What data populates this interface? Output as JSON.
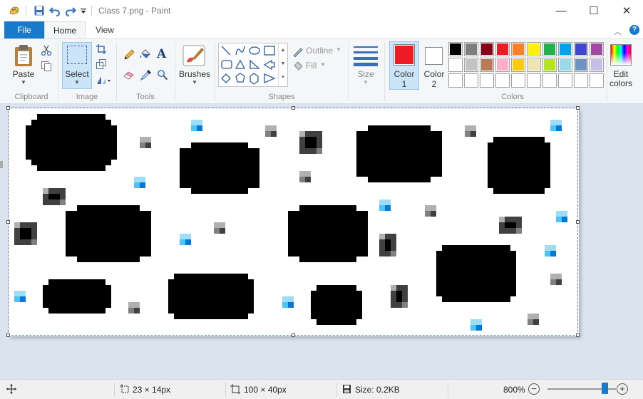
{
  "window": {
    "title": "Class 7.png - Paint",
    "minimize": "—",
    "maximize": "☐",
    "close": "✕"
  },
  "tabs": {
    "file": "File",
    "home": "Home",
    "view": "View"
  },
  "ribbon": {
    "clipboard": {
      "label": "Clipboard",
      "paste": "Paste"
    },
    "image": {
      "label": "Image",
      "select": "Select"
    },
    "tools": {
      "label": "Tools"
    },
    "brushes": {
      "label": "Brushes"
    },
    "shapes": {
      "label": "Shapes",
      "outline": "Outline",
      "fill": "Fill"
    },
    "size": {
      "label": "Size"
    },
    "color1": {
      "label": "Color",
      "num": "1",
      "value": "#ed1c24"
    },
    "color2": {
      "label": "Color",
      "num": "2",
      "value": "#ffffff"
    },
    "colors": {
      "label": "Colors"
    },
    "edit_colors": {
      "line1": "Edit",
      "line2": "colors"
    }
  },
  "palette": {
    "row1": [
      "#000000",
      "#7f7f7f",
      "#880015",
      "#ed1c24",
      "#ff7f27",
      "#fff200",
      "#22b14c",
      "#00a2e8",
      "#3f48cc",
      "#a349a4"
    ],
    "row2": [
      "#ffffff",
      "#c3c3c3",
      "#b97a57",
      "#ffaec9",
      "#ffc90e",
      "#efe4b0",
      "#b5e61d",
      "#99d9ea",
      "#7092be",
      "#c8bfe7"
    ],
    "row3": [
      "#ffffff",
      "#ffffff",
      "#ffffff",
      "#ffffff",
      "#ffffff",
      "#ffffff",
      "#ffffff",
      "#ffffff",
      "#ffffff",
      "#ffffff"
    ]
  },
  "canvas_image": {
    "ink_color": "#000000",
    "accent_colors": [
      "#0078d7",
      "#4fc3f7",
      "#9fdcf5"
    ],
    "gray_colors": [
      "#404040",
      "#808080",
      "#b0b0b0"
    ]
  },
  "status": {
    "selection_size": "23 × 14px",
    "image_size": "100 × 40px",
    "file_size": "Size: 0.2KB",
    "zoom": "800%",
    "zoom_out": "−",
    "zoom_in": "+",
    "zoom_level": 0.83
  }
}
